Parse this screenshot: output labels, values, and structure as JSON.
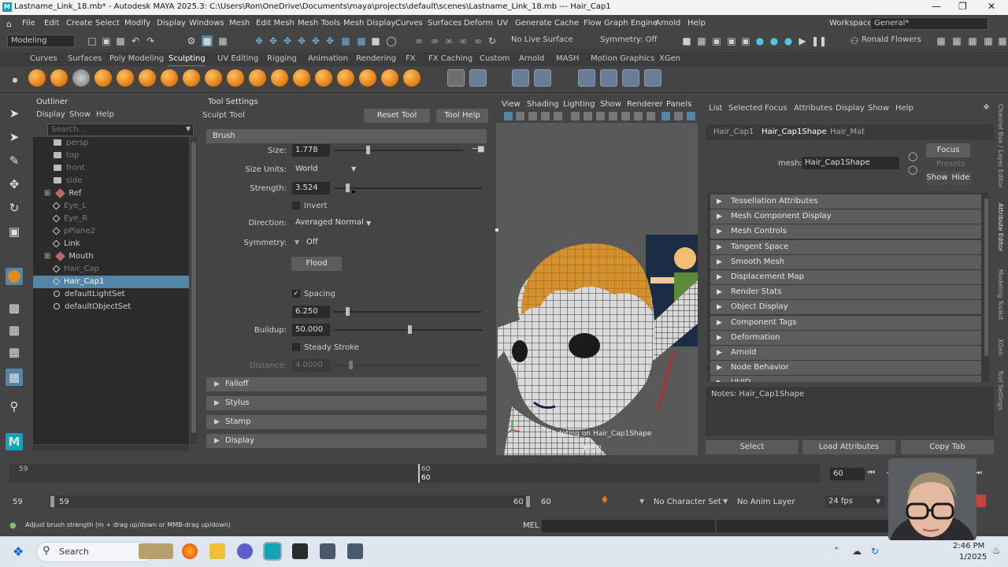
{
  "titlebar": {
    "title": "Lastname_Link_18.mb* - Autodesk MAYA 2025.3: C:\\Users\\Ron\\OneDrive\\Documents\\maya\\projects\\default\\scenes\\Lastname_Link_18.mb   ---   Hair_Cap1"
  },
  "menubar": {
    "items": [
      "File",
      "Edit",
      "Create",
      "Select",
      "Modify",
      "Display",
      "Windows",
      "Mesh",
      "Edit Mesh",
      "Mesh Tools",
      "Mesh Display",
      "Curves",
      "Surfaces",
      "Deform",
      "UV",
      "Generate",
      "Cache",
      "Flow Graph Engine",
      "Arnold",
      "Help"
    ],
    "workspace_label": "Workspace:",
    "workspace_value": "General*"
  },
  "statusline": {
    "mode": "Modeling",
    "live_surface": "No Live Surface",
    "symmetry": "Symmetry: Off",
    "user": "Ronald Flowers"
  },
  "shelf": {
    "tabs": [
      "Curves",
      "Surfaces",
      "Poly Modeling",
      "Sculpting",
      "UV Editing",
      "Rigging",
      "Animation",
      "Rendering",
      "FX",
      "FX Caching",
      "Custom",
      "Arnold",
      "MASH",
      "Motion Graphics",
      "XGen"
    ],
    "active_tab": "Sculpting"
  },
  "outliner": {
    "title": "Outliner",
    "menu": [
      "Display",
      "Show",
      "Help"
    ],
    "search_placeholder": "Search...",
    "rows": [
      {
        "label": "persp",
        "type": "cam",
        "dim": true
      },
      {
        "label": "top",
        "type": "cam",
        "dim": true
      },
      {
        "label": "front",
        "type": "cam",
        "dim": true
      },
      {
        "label": "side",
        "type": "cam",
        "dim": true
      },
      {
        "label": "Ref",
        "type": "grp",
        "dim": false
      },
      {
        "label": "Eye_L",
        "type": "mesh",
        "dim": true
      },
      {
        "label": "Eye_R",
        "type": "mesh",
        "dim": true
      },
      {
        "label": "pPlane2",
        "type": "mesh",
        "dim": true
      },
      {
        "label": "Link",
        "type": "mesh",
        "dim": false
      },
      {
        "label": "Mouth",
        "type": "grp",
        "dim": false
      },
      {
        "label": "Hair_Cap",
        "type": "mesh",
        "dim": true
      },
      {
        "label": "Hair_Cap1",
        "type": "mesh",
        "dim": false,
        "selected": true
      },
      {
        "label": "defaultLightSet",
        "type": "set",
        "dim": false
      },
      {
        "label": "defaultObjectSet",
        "type": "set",
        "dim": false
      }
    ]
  },
  "tool_settings": {
    "title": "Tool Settings",
    "tool_name": "Sculpt Tool",
    "reset_button": "Reset Tool",
    "help_button": "Tool Help",
    "brush_section": "Brush",
    "size_label": "Size:",
    "size_value": "1.778",
    "size_fraction": 0.25,
    "size_units_label": "Size Units:",
    "size_units_value": "World",
    "strength_label": "Strength:",
    "strength_value": "3.524",
    "strength_fraction": 0.08,
    "invert_label": "Invert",
    "direction_label": "Direction:",
    "direction_value": "Averaged Normal",
    "symmetry_label": "Symmetry:",
    "symmetry_value": "Off",
    "flood_button": "Flood",
    "spacing_label": "Spacing",
    "spacing_value": "6.250",
    "spacing_fraction": 0.08,
    "buildup_label": "Buildup:",
    "buildup_value": "50.000",
    "buildup_fraction": 0.5,
    "steady_stroke_label": "Steady Stroke",
    "distance_label": "Distance:",
    "distance_value": "4.0000",
    "distance_fraction": 0.1,
    "sections": [
      "Falloff",
      "Stylus",
      "Stamp",
      "Display"
    ]
  },
  "viewport": {
    "menu": [
      "View",
      "Shading",
      "Lighting",
      "Show",
      "Renderer",
      "Panels"
    ],
    "hud_text": "Sculpting on Hair_Cap1Shape",
    "camera": "persp"
  },
  "attribute_editor": {
    "menu": [
      "List",
      "Selected",
      "Focus",
      "Attributes",
      "Display",
      "Show",
      "Help"
    ],
    "tabs": [
      "Hair_Cap1",
      "Hair_Cap1Shape",
      "Hair_Mat"
    ],
    "active_tab": "Hair_Cap1Shape",
    "mesh_label": "mesh:",
    "mesh_value": "Hair_Cap1Shape",
    "focus_button": "Focus",
    "presets_button": "Presets",
    "show_button": "Show",
    "hide_button": "Hide",
    "sections": [
      "Tessellation Attributes",
      "Mesh Component Display",
      "Mesh Controls",
      "Tangent Space",
      "Smooth Mesh",
      "Displacement Map",
      "Render Stats",
      "Object Display",
      "Component Tags",
      "Deformation",
      "Arnold",
      "Node Behavior",
      "UUID"
    ],
    "notes": "Notes: Hair_Cap1Shape",
    "buttons": [
      "Select",
      "Load Attributes",
      "Copy Tab"
    ],
    "side_tabs": [
      "Channel Box / Layer Editor",
      "Attribute Editor",
      "Modeling Toolkit",
      "XGen",
      "Tool Settings"
    ]
  },
  "time": {
    "current_frame_left": "59",
    "playhead_label": "60",
    "playhead_frame": "60",
    "current_frame_field": "60",
    "range_start": "59",
    "range_start_inner": "59",
    "range_end_inner": "60",
    "range_end": "60",
    "character_set": "No Character Set",
    "anim_layer": "No Anim Layer",
    "fps": "24 fps"
  },
  "command_line": {
    "help_text": "Adjust brush strength (m + drag up/down or MMB-drag up/down)",
    "mel_label": "MEL"
  },
  "taskbar": {
    "search_placeholder": "Search",
    "time": "2:46 PM",
    "date": "1/2025"
  }
}
